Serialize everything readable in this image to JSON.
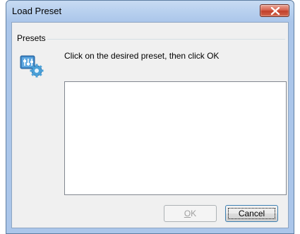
{
  "window": {
    "title": "Load Preset",
    "close_icon": "close-icon"
  },
  "group": {
    "label": "Presets"
  },
  "instruction": "Click on the desired preset, then click OK",
  "preset_list": {
    "items": []
  },
  "buttons": {
    "ok_label": "OK",
    "ok_enabled": false,
    "cancel_label": "Cancel"
  },
  "colors": {
    "title_gradient": "#b9d1ef",
    "close_red": "#c1402b",
    "dialog_bg": "#f0f0f0"
  }
}
